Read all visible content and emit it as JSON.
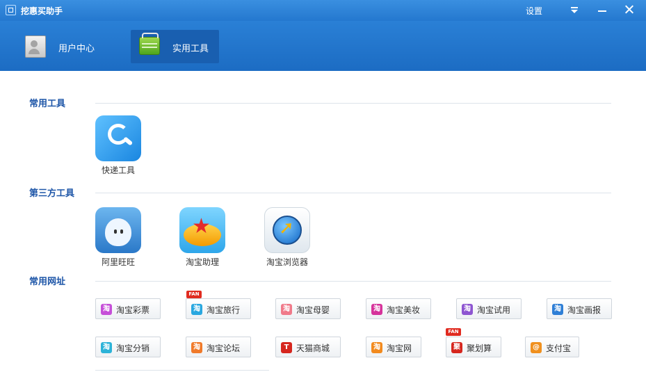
{
  "window": {
    "title": "挖惠买助手",
    "settings_label": "设置"
  },
  "nav": {
    "tabs": [
      {
        "label": "用户中心",
        "active": false
      },
      {
        "label": "实用工具",
        "active": true
      }
    ]
  },
  "sections": {
    "common_tools": {
      "title": "常用工具",
      "items": [
        {
          "label": "快递工具",
          "icon": "express-icon"
        }
      ]
    },
    "third_party": {
      "title": "第三方工具",
      "items": [
        {
          "label": "阿里旺旺",
          "icon": "aliwangwang-icon"
        },
        {
          "label": "淘宝助理",
          "icon": "taobao-assistant-icon"
        },
        {
          "label": "淘宝浏览器",
          "icon": "taobao-browser-icon"
        }
      ]
    },
    "sites": {
      "title": "常用网址",
      "row1": [
        {
          "label": "淘宝彩票",
          "icon_text": "淘",
          "color": "#c64fd8"
        },
        {
          "label": "淘宝旅行",
          "icon_text": "淘",
          "color": "#2aa8e0",
          "badge": "FAN"
        },
        {
          "label": "淘宝母婴",
          "icon_text": "淘",
          "color": "#f07a8a"
        },
        {
          "label": "淘宝美妆",
          "icon_text": "淘",
          "color": "#d6339b"
        },
        {
          "label": "淘宝试用",
          "icon_text": "淘",
          "color": "#8e55d1"
        },
        {
          "label": "淘宝画报",
          "icon_text": "淘",
          "color": "#2f7fd6"
        }
      ],
      "row2": [
        {
          "label": "淘宝分销",
          "icon_text": "淘",
          "color": "#2cb3d8"
        },
        {
          "label": "淘宝论坛",
          "icon_text": "淘",
          "color": "#f07a2a"
        },
        {
          "label": "天猫商城",
          "icon_text": "T",
          "color": "#d6261e"
        },
        {
          "label": "淘宝网",
          "icon_text": "淘",
          "color": "#f28a1e"
        },
        {
          "label": "聚划算",
          "icon_text": "聚",
          "color": "#d6261e",
          "badge": "FAN"
        },
        {
          "label": "支付宝",
          "icon_text": "@",
          "color": "#f0901e"
        }
      ]
    }
  }
}
